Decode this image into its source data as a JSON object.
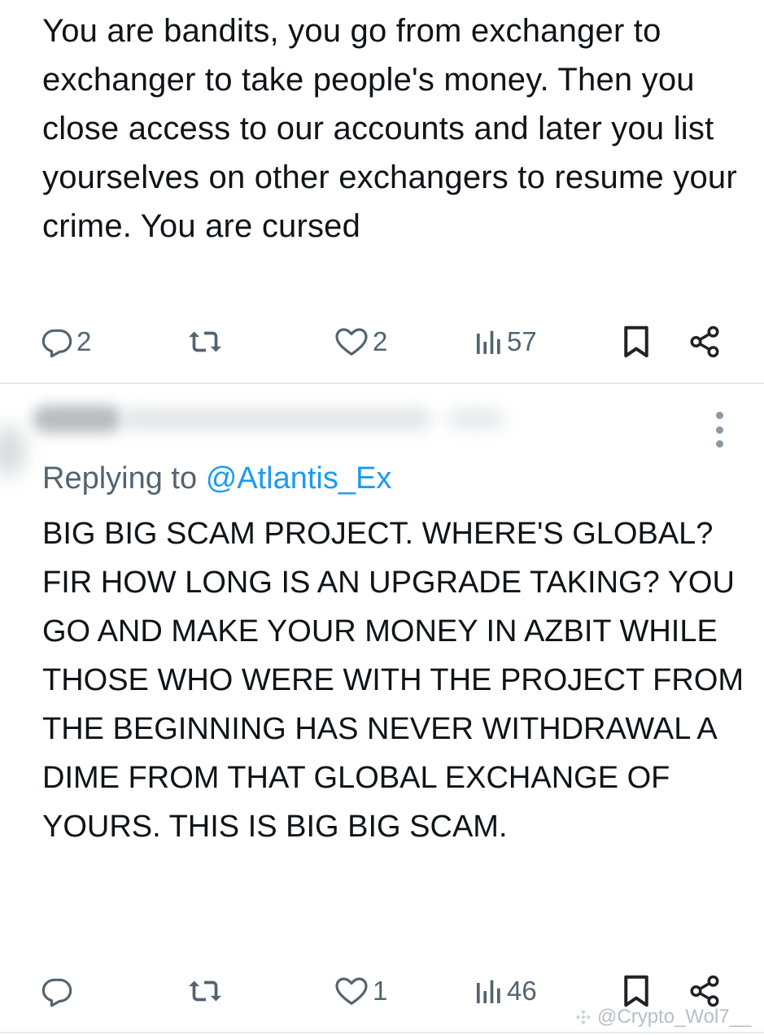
{
  "tweet1": {
    "text": "You are bandits, you go from exchanger to exchanger to take people's money. Then you close access to our accounts and later you list yourselves on other exchangers to resume your crime. You are cursed",
    "replies": "2",
    "retweets": "",
    "likes": "2",
    "views": "57"
  },
  "tweet2": {
    "replying_prefix": "Replying to",
    "replying_handle": "@Atlantis_Ex",
    "text": "BIG BIG SCAM PROJECT. WHERE'S GLOBAL? FIR HOW LONG IS AN UPGRADE TAKING? YOU GO AND MAKE YOUR MONEY IN AZBIT WHILE THOSE WHO WERE WITH THE PROJECT FROM THE BEGINNING HAS NEVER WITHDRAWAL A DIME FROM THAT GLOBAL EXCHANGE OF YOURS. THIS IS BIG BIG SCAM.",
    "replies": "",
    "retweets": "",
    "likes": "1",
    "views": "46"
  },
  "watermark": "@Crypto_Wol7__",
  "icons": {
    "reply": "reply-icon",
    "retweet": "retweet-icon",
    "like": "heart-icon",
    "views": "views-icon",
    "bookmark": "bookmark-icon",
    "share": "share-icon",
    "more": "more-icon"
  },
  "colors": {
    "text": "#0f1419",
    "muted": "#536471",
    "link": "#1d9bf0",
    "divider": "#e6e9ec"
  }
}
